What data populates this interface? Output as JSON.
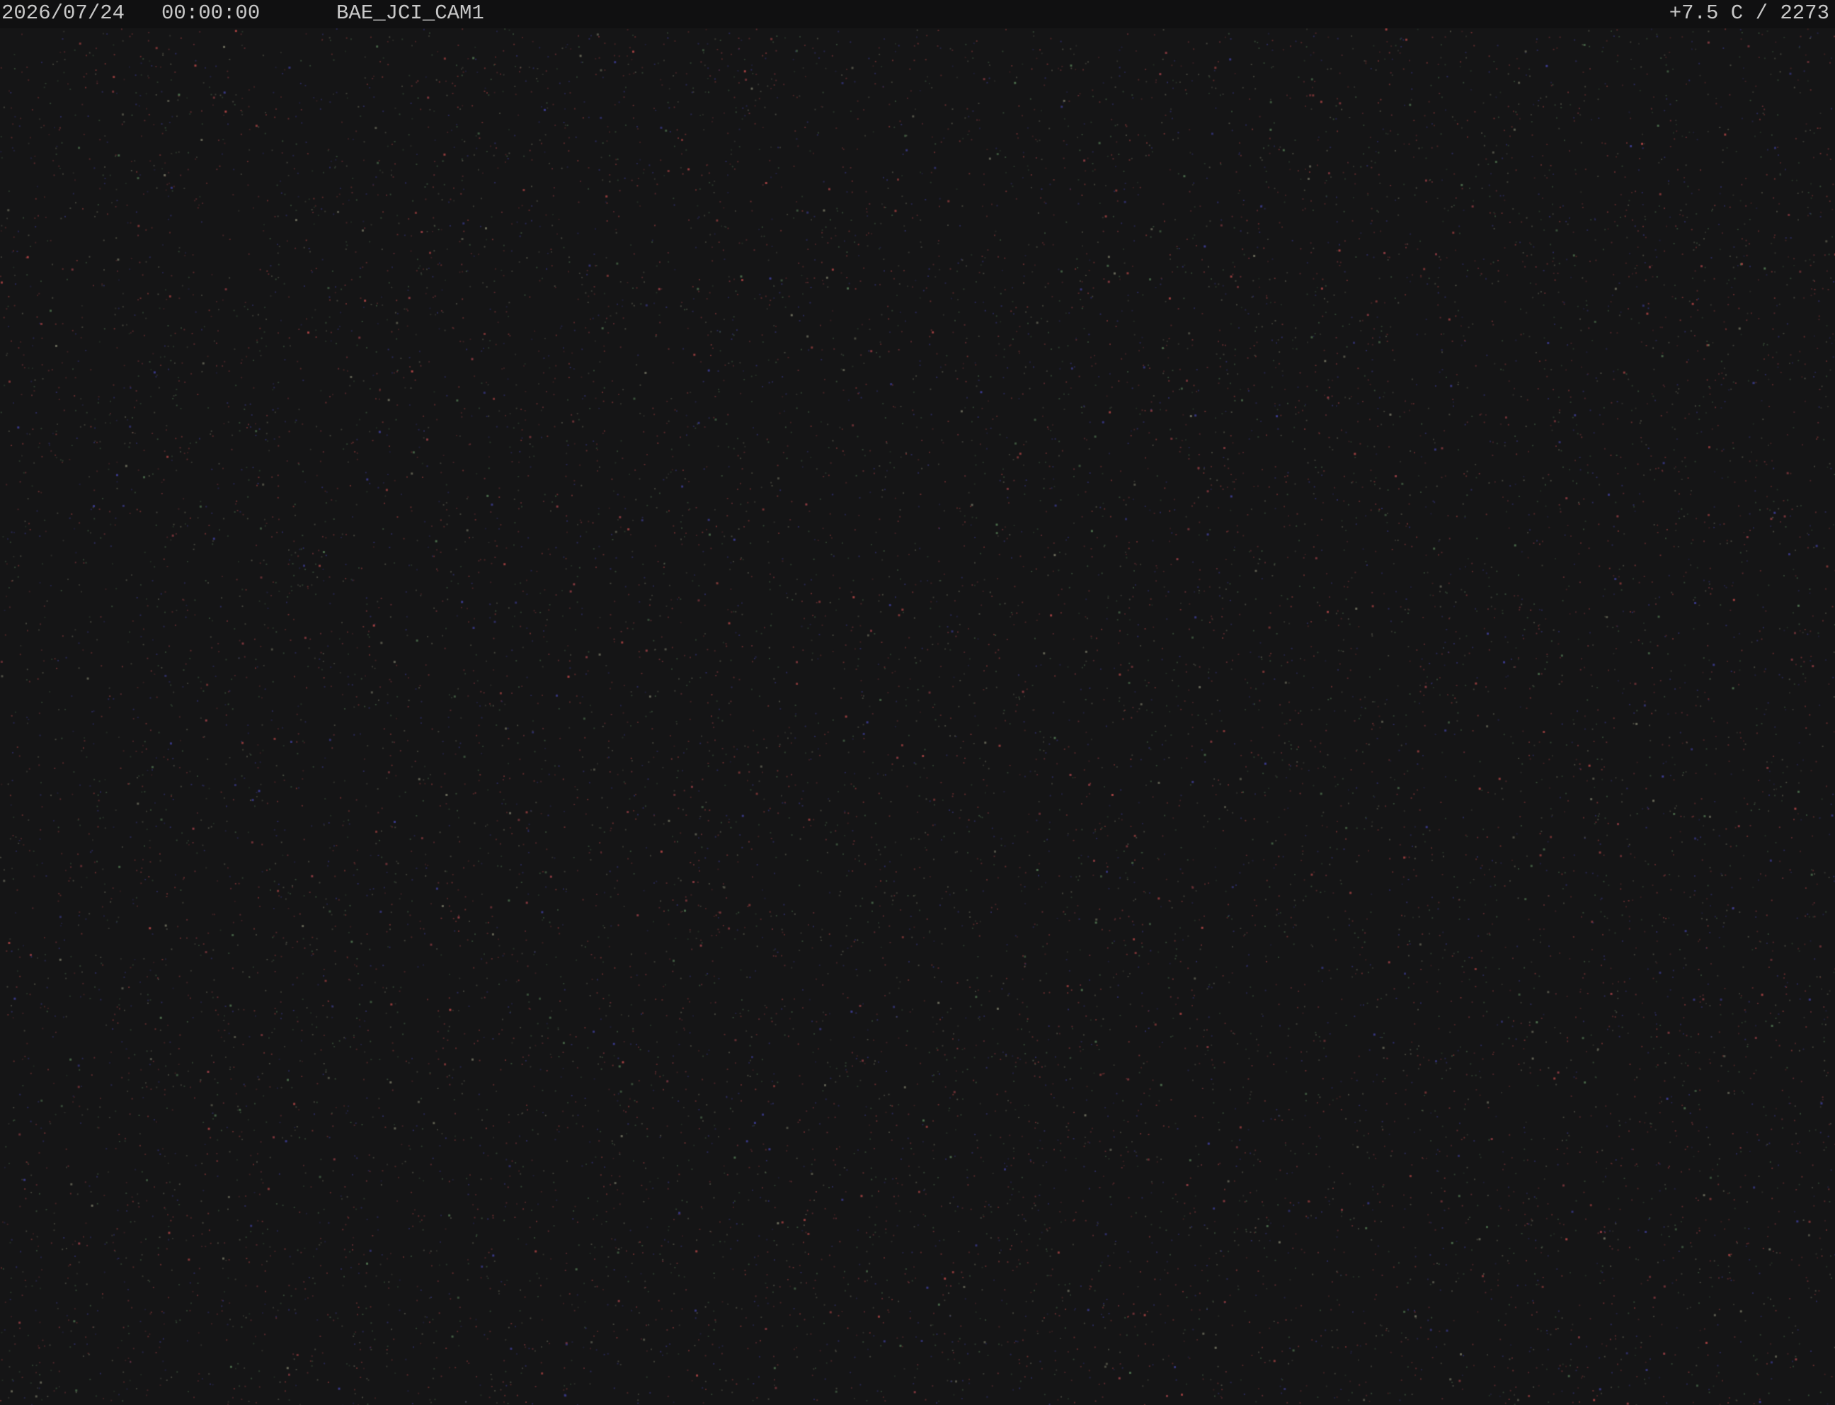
{
  "overlay": {
    "date": "2026/07/24",
    "time": "00:00:00",
    "camera_id": "BAE_JCI_CAM1",
    "temperature_readout": "+7.5 C / 2273",
    "text_color": "#c8c8c8"
  },
  "image": {
    "background_color": "#151516",
    "noise_colors": [
      "#8a3a40",
      "#3a3a8a",
      "#4a6a4a",
      "#6a6a5a",
      "#a04040"
    ]
  }
}
